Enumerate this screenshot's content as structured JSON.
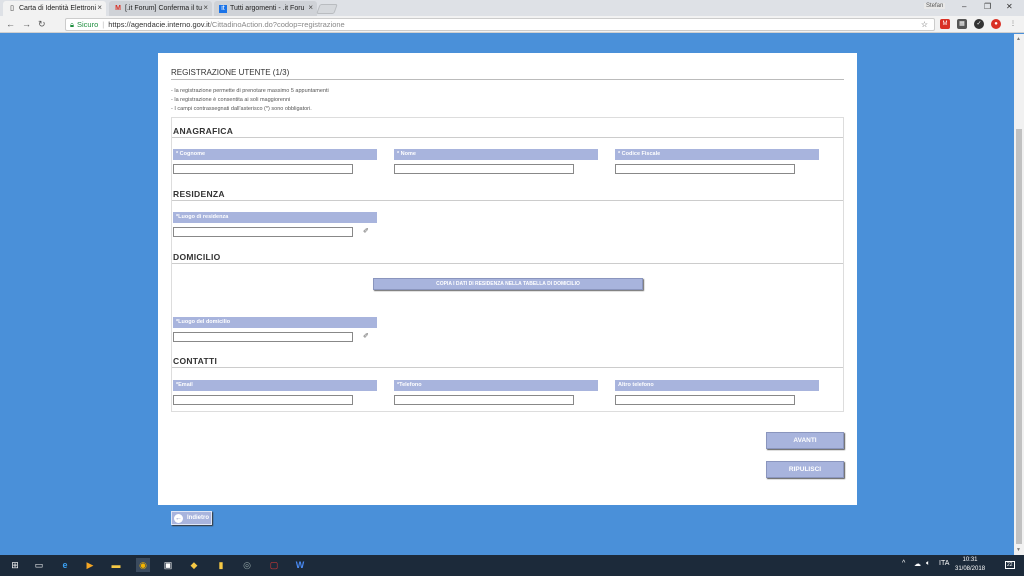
{
  "browser": {
    "tabs": [
      {
        "label": "Carta di Identità Elettroni",
        "icon": "document-icon"
      },
      {
        "label": "[.it Forum] Conferma il tu",
        "icon": "gmail-icon"
      },
      {
        "label": "Tutti argomenti - .it Foru",
        "icon": "forum-icon"
      }
    ],
    "user": "Stefan",
    "secure_label": "Sicuro",
    "url_host": "https://agendacie.interno.gov.it",
    "url_path": "/CittadinoAction.do?codop=registrazione"
  },
  "form": {
    "title": "REGISTRAZIONE UTENTE (1/3)",
    "notes": [
      "- la registrazione permette di prenotare massimo 5 appuntamenti",
      "- la registrazione è consentita ai soli maggiorenni",
      "- I campi contrassegnati dall'asterisco (*) sono obbligatori."
    ],
    "sections": {
      "anagrafica": "ANAGRAFICA",
      "residenza": "RESIDENZA",
      "domicilio": "DOMICILIO",
      "contatti": "CONTATTI"
    },
    "fields": {
      "cognome": {
        "label": "* Cognome",
        "value": ""
      },
      "nome": {
        "label": "* Nome",
        "value": ""
      },
      "codice_fiscale": {
        "label": "* Codice Fiscale",
        "value": ""
      },
      "luogo_residenza": {
        "label": "*Luogo di residenza",
        "value": ""
      },
      "luogo_domicilio": {
        "label": "*Luogo del domicilio",
        "value": ""
      },
      "email": {
        "label": "*Email",
        "value": ""
      },
      "telefono": {
        "label": "*Telefono",
        "value": ""
      },
      "altro_telefono": {
        "label": "Altro telefono",
        "value": ""
      }
    },
    "copy_button": "COPIA I DATI DI RESIDENZA NELLA TABELLA DI DOMICILIO",
    "avanti_button": "AVANTI",
    "ripulisci_button": "RIPULISCI",
    "back_button": "Indietro"
  },
  "taskbar": {
    "language": "ITA",
    "time": "10:31",
    "date": "31/08/2018",
    "notification_count": "22"
  },
  "colors": {
    "page_background": "#4a90d9",
    "label_background": "#a8b4dd"
  }
}
